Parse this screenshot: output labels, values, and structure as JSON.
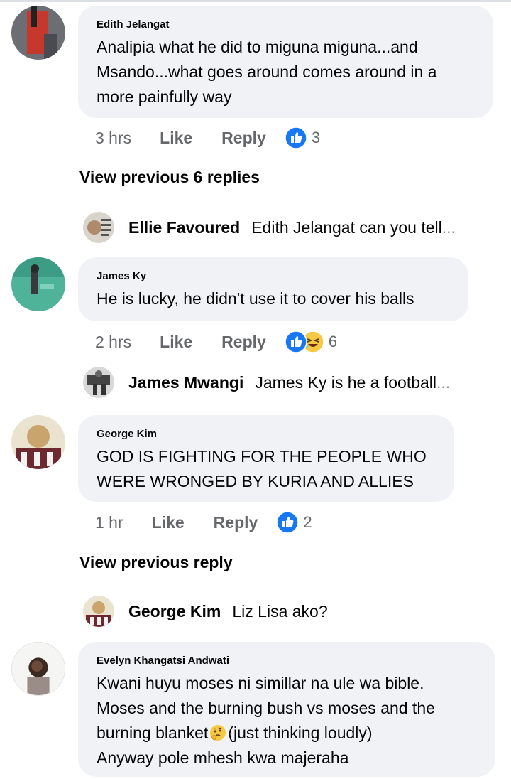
{
  "comments": [
    {
      "name": "Edith Jelangat",
      "lines": [
        "Analipia what he did to miguna miguna...and",
        "Msando...what goes around comes around in a",
        "more painfully way"
      ],
      "time": "3 hrs",
      "like": "Like",
      "reply": "Reply",
      "reaction_count": "3"
    },
    {
      "name": "James Ky",
      "lines": [
        "He is lucky, he didn't use it to cover his balls"
      ],
      "time": "2 hrs",
      "like": "Like",
      "reply": "Reply",
      "reaction_count": "6"
    },
    {
      "name": "George Kim",
      "lines": [
        "GOD IS FIGHTING FOR THE PEOPLE WHO",
        "WERE WRONGED BY KURIA AND ALLIES"
      ],
      "time": "1 hr",
      "like": "Like",
      "reply": "Reply",
      "reaction_count": "2"
    },
    {
      "name": "Evelyn Khangatsi Andwati",
      "lines": [
        "Kwani huyu moses ni simillar na ule wa bible.",
        "Moses and the burning bush vs  moses and the",
        "burning blanket",
        "(just thinking loudly)",
        "Anyway pole mhesh kwa majeraha"
      ]
    }
  ],
  "view_previous_1": "View previous 6 replies",
  "view_previous_2": "View previous reply",
  "replies": [
    {
      "name": "Ellie Favoured",
      "text": "Edith Jelangat can you tell",
      "ellipsis": "..."
    },
    {
      "name": "James Mwangi",
      "text": "James Ky is he a football",
      "ellipsis": "..."
    },
    {
      "name": "George Kim",
      "text": "Liz Lisa ako?"
    }
  ],
  "colors": {
    "like_blue": "#1877f2",
    "bubble_bg": "#f0f2f5",
    "meta_gray": "#65676b"
  },
  "icons": {
    "like": "thumbs-up-reaction-icon",
    "haha": "laughing-reaction-icon",
    "thinking": "thinking-face-emoji"
  }
}
